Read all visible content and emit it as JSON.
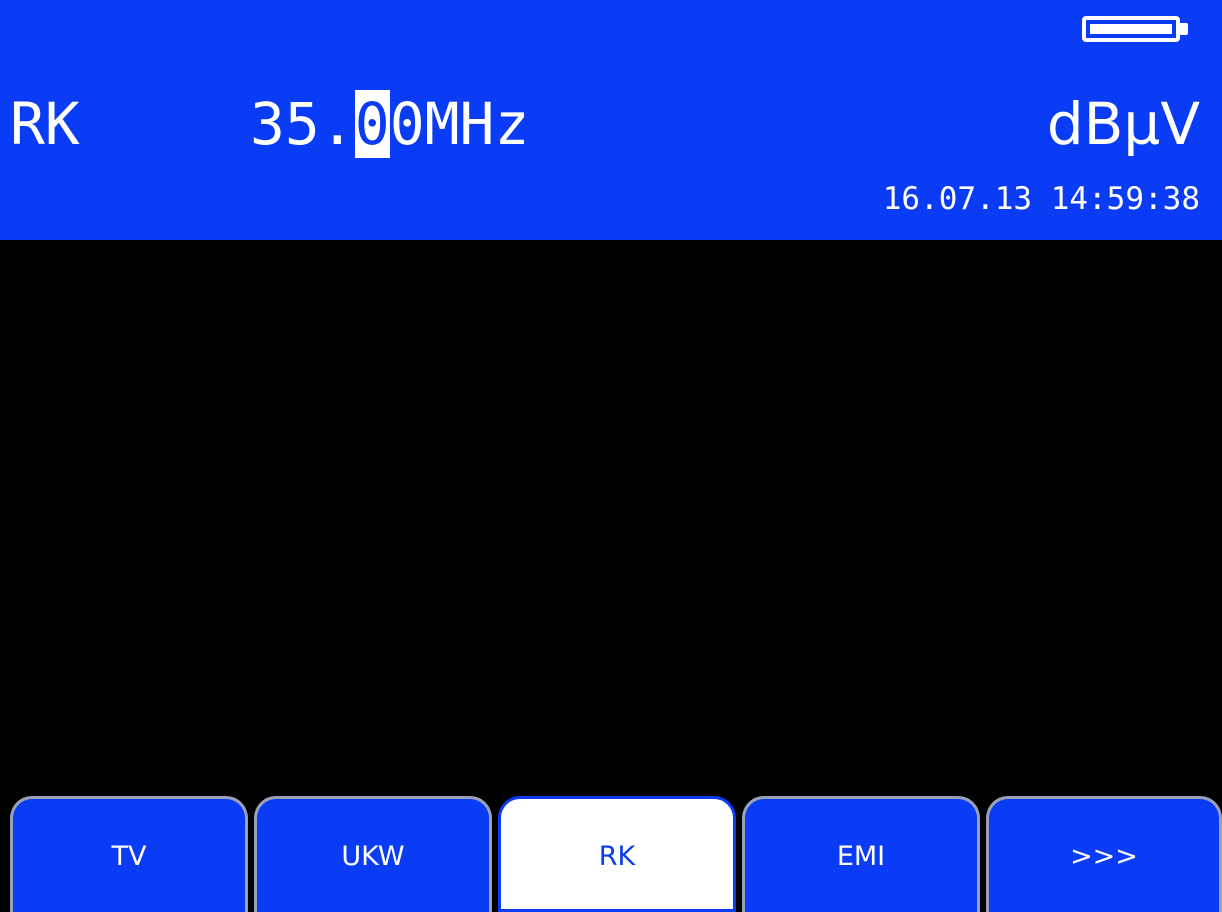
{
  "header": {
    "mode": "RK",
    "frequency_before_cursor": "35.",
    "frequency_cursor_digit": "0",
    "frequency_after_cursor": "0MHz",
    "unit": "dBµV",
    "datetime": "16.07.13 14:59:38",
    "battery_icon": "battery-full-icon"
  },
  "softkeys": [
    {
      "label": "TV",
      "active": false
    },
    {
      "label": "UKW",
      "active": false
    },
    {
      "label": "RK",
      "active": true
    },
    {
      "label": "EMI",
      "active": false
    },
    {
      "label": ">>>",
      "active": false
    }
  ],
  "colors": {
    "header_background": "#0a3cf5",
    "screen_background": "#000000",
    "softkey_background": "#0a3cf5",
    "softkey_active_background": "#ffffff",
    "text": "#ffffff"
  }
}
